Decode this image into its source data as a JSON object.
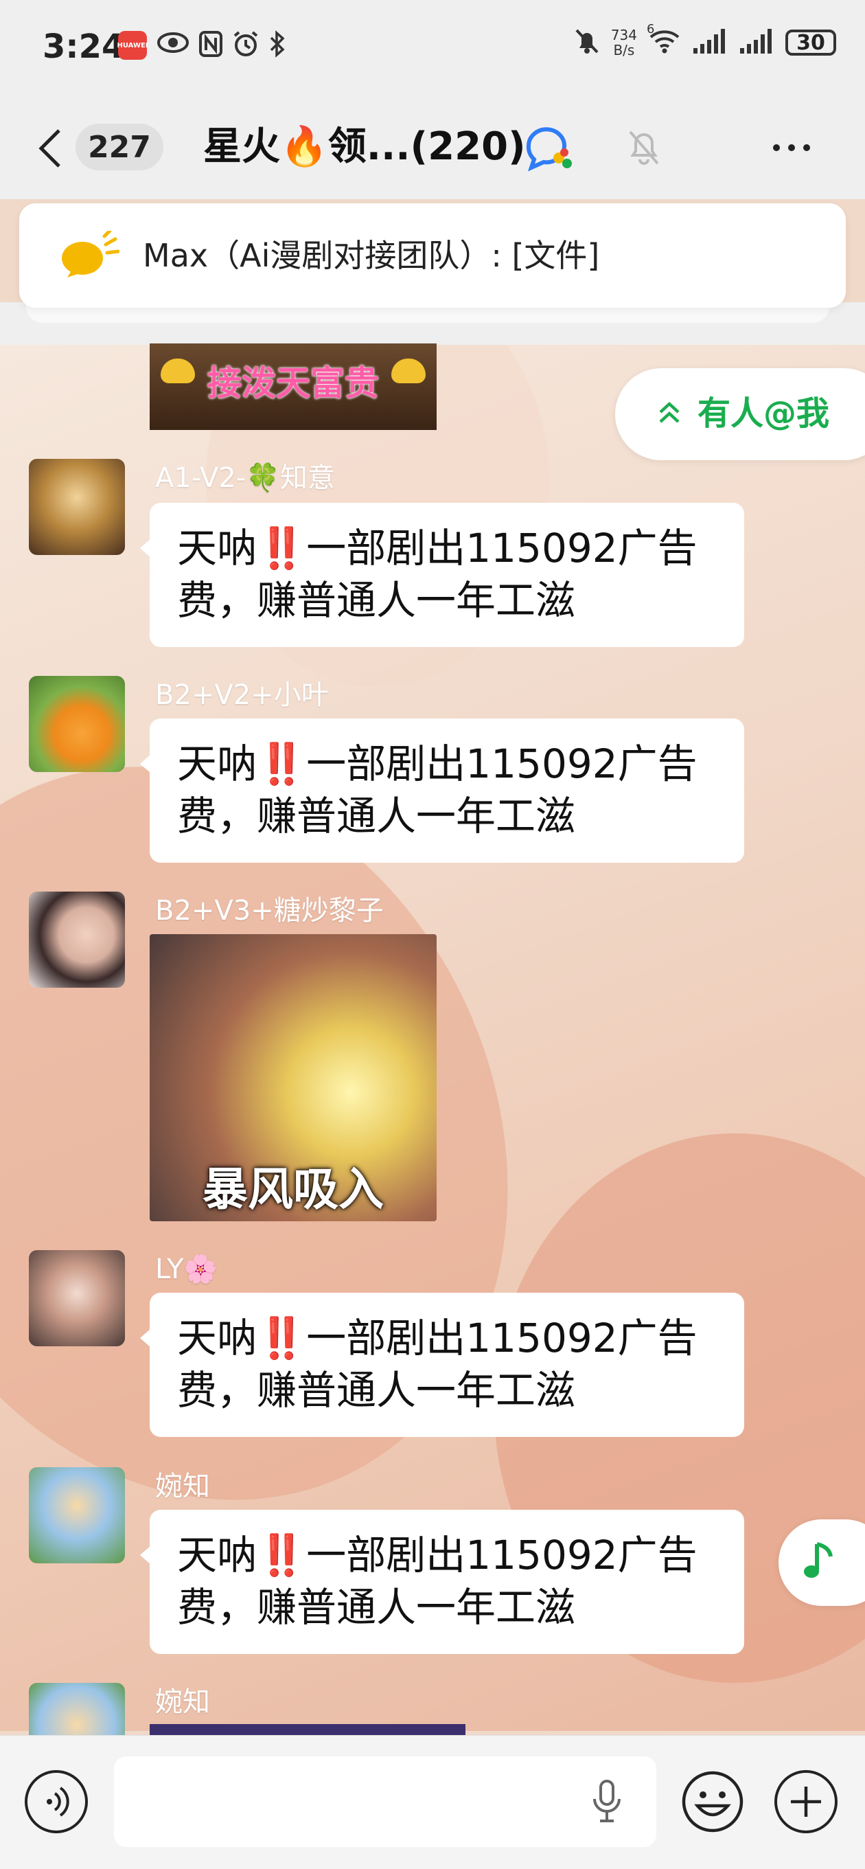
{
  "status_bar": {
    "time": "3:24",
    "app_badge": "HUAWEI",
    "net_speed_value": "734",
    "net_speed_unit": "B/s",
    "wifi_label": "6",
    "battery": "30"
  },
  "header": {
    "unread_count": "227",
    "title": "星火🔥领...(220)"
  },
  "pinned_notice": {
    "text": "Max（Ai漫剧对接团队）: [文件]"
  },
  "top_sticker": {
    "caption": "接泼天富贵"
  },
  "mention_button": {
    "label": "有人@我"
  },
  "messages": [
    {
      "sender": "A1-V2-🍀知意",
      "line1_prefix": "天呐",
      "bang": "‼️",
      "line1_suffix": "一部剧出115092广告",
      "line2": "费，赚普通人一年工滋"
    },
    {
      "sender": "B2+V2+小叶",
      "line1_prefix": "天呐",
      "bang": "‼️",
      "line1_suffix": "一部剧出115092广告",
      "line2": "费，赚普通人一年工滋"
    },
    {
      "sender": "B2+V3+糖炒黎子",
      "sticker_caption": "暴风吸入"
    },
    {
      "sender": "LY🌸",
      "line1_prefix": "天呐",
      "bang": "‼️",
      "line1_suffix": "一部剧出115092广告",
      "line2": "费，赚普通人一年工滋"
    },
    {
      "sender": "婉知",
      "line1_prefix": "天呐",
      "bang": "‼️",
      "line1_suffix": "一部剧出115092广告",
      "line2": "费，赚普通人一年工滋"
    },
    {
      "sender": "婉知"
    }
  ],
  "icons": {
    "back": "chevron-left-icon",
    "group": "group-chat-icon",
    "mute": "bell-muted-icon",
    "more": "more-dots-icon",
    "notice": "megaphone-icon",
    "music": "music-note-icon",
    "voice": "voice-mode-icon",
    "mic": "microphone-icon",
    "emoji": "emoji-icon",
    "plus": "plus-icon"
  },
  "colors": {
    "accent_green": "#1aad4e",
    "bang_red": "#e02020",
    "notice_yellow": "#f5b800"
  }
}
